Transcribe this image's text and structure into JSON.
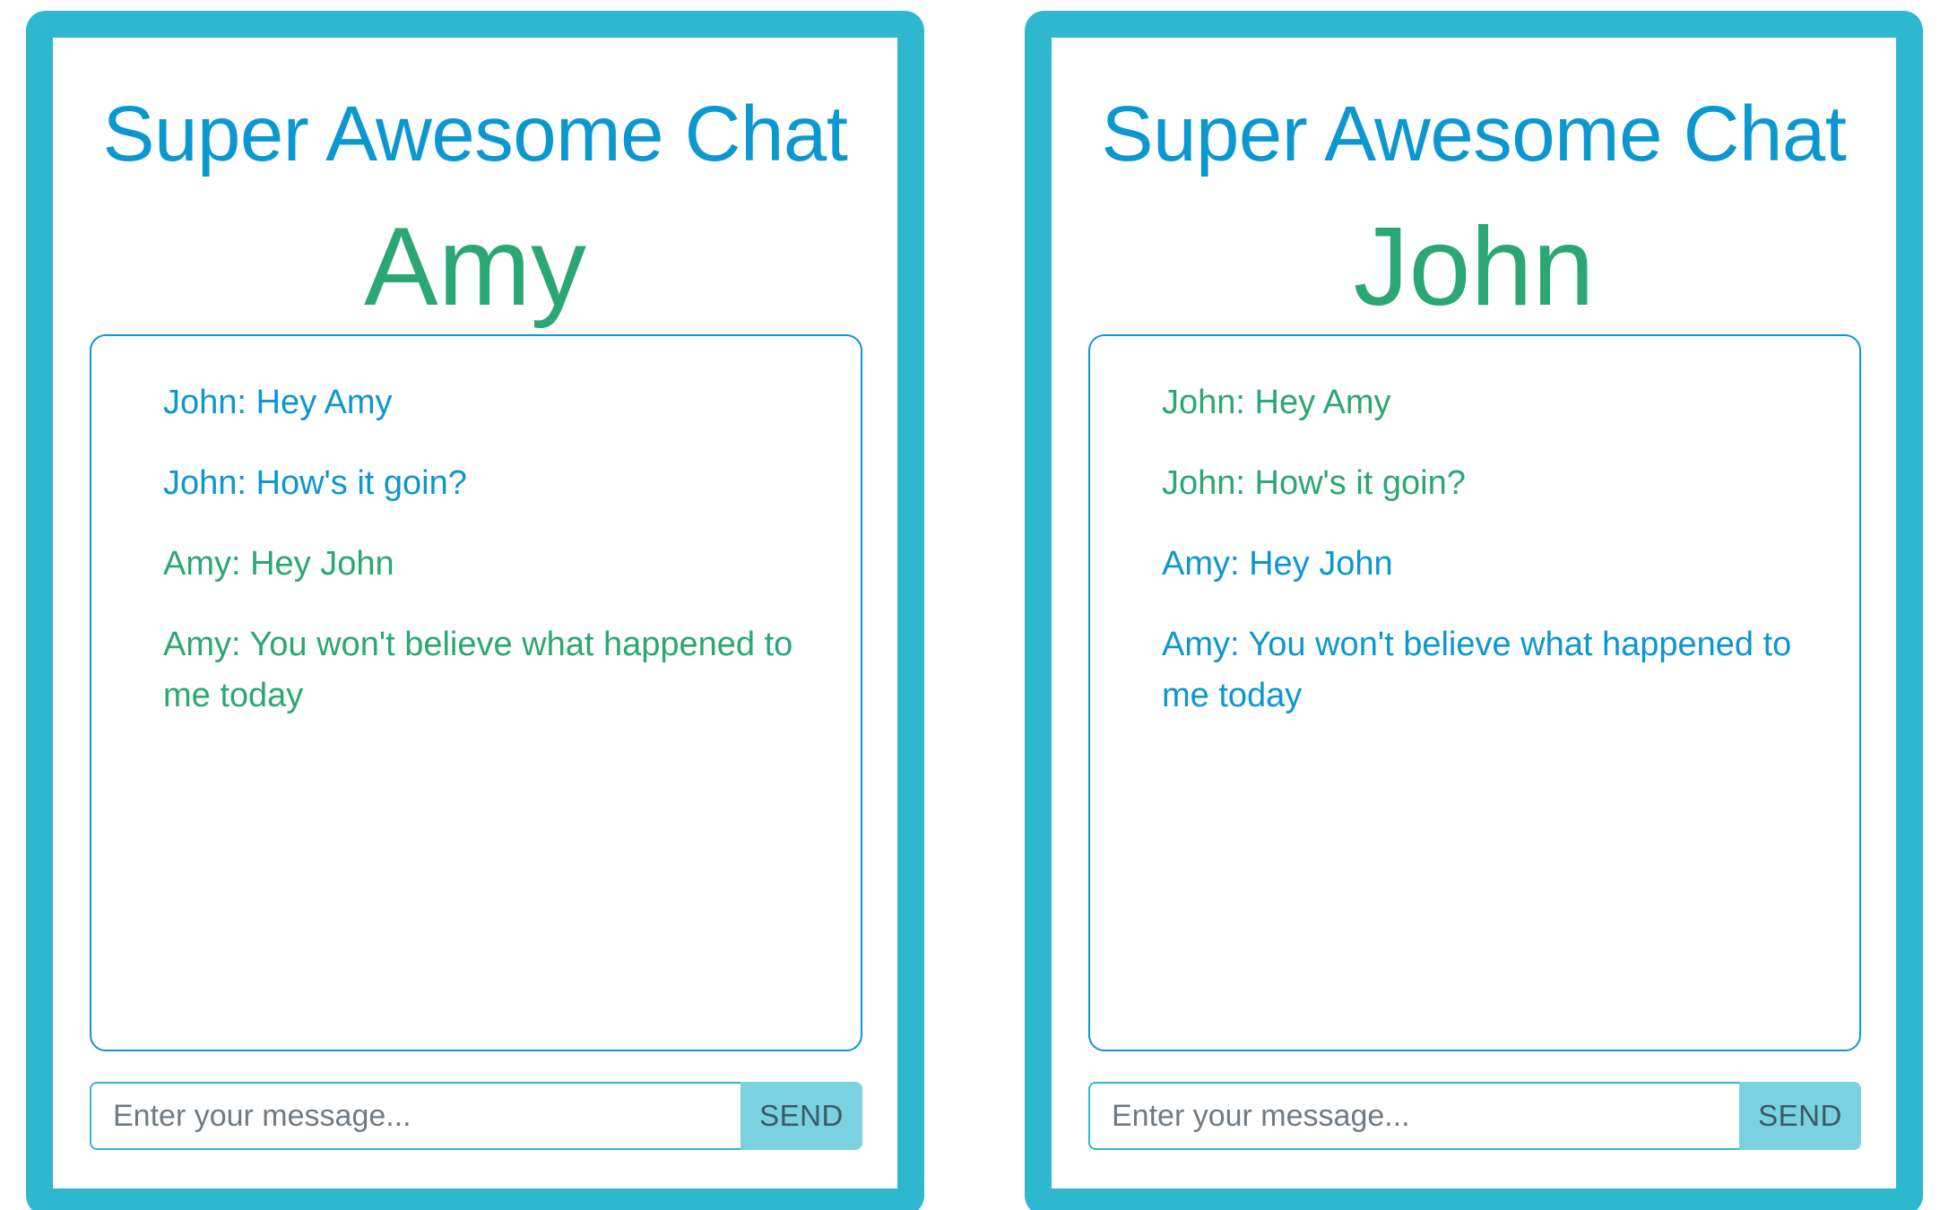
{
  "colors": {
    "frame": "#2eb8d0",
    "title": "#0b97cf",
    "username": "#2aa774",
    "blue_message": "#0b97cf",
    "green_message": "#2aa774",
    "send_button": "#7ad1e0"
  },
  "panels": [
    {
      "title": "Super Awesome Chat",
      "username": "Amy",
      "messages": [
        {
          "text": "John: Hey Amy",
          "color": "blue"
        },
        {
          "text": "John: How's it goin?",
          "color": "blue"
        },
        {
          "text": "Amy: Hey John",
          "color": "green"
        },
        {
          "text": "Amy: You won't believe what happened to me today",
          "color": "green"
        }
      ],
      "input": {
        "value": "",
        "placeholder": "Enter your message..."
      },
      "send_label": "SEND"
    },
    {
      "title": "Super Awesome Chat",
      "username": "John",
      "messages": [
        {
          "text": "John: Hey Amy",
          "color": "green"
        },
        {
          "text": "John: How's it goin?",
          "color": "green"
        },
        {
          "text": "Amy: Hey John",
          "color": "blue"
        },
        {
          "text": "Amy: You won't believe what happened to me today",
          "color": "blue"
        }
      ],
      "input": {
        "value": "",
        "placeholder": "Enter your message..."
      },
      "send_label": "SEND"
    }
  ]
}
